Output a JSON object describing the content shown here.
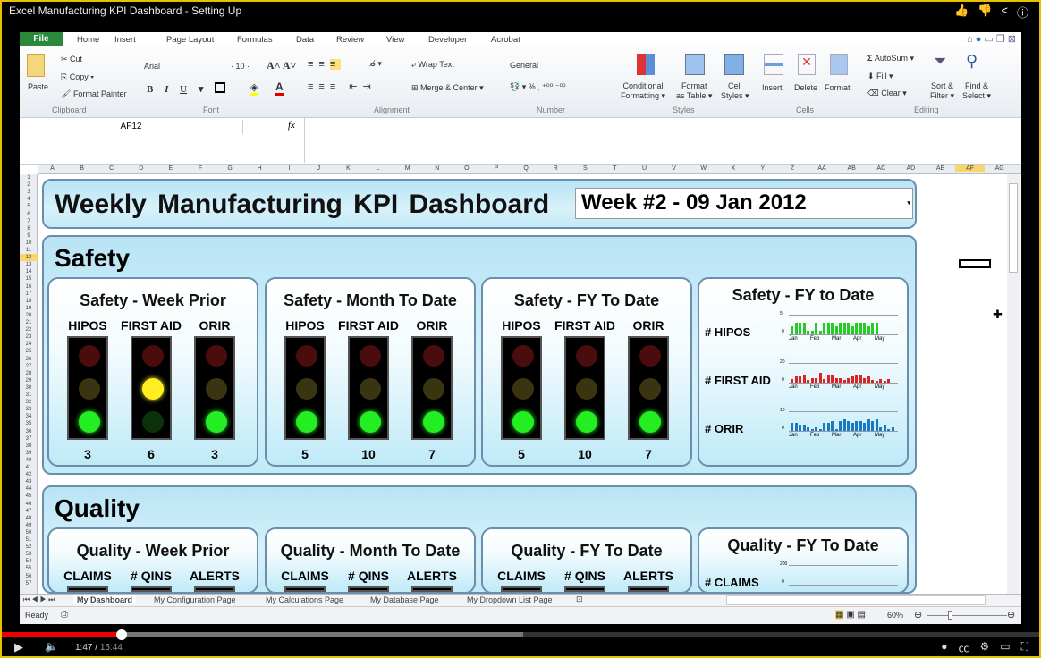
{
  "video": {
    "title": "Excel Manufacturing KPI Dashboard - Setting Up",
    "time_current": "1:47",
    "time_total": "15:44",
    "progress_pct": 11.7,
    "buffered_pct": 50.3
  },
  "ribbon": {
    "tabs": [
      "Home",
      "Insert",
      "Page Layout",
      "Formulas",
      "Data",
      "Review",
      "View",
      "Developer",
      "Acrobat"
    ],
    "file": "File",
    "paste": "Paste",
    "cut": "Cut",
    "copy": "Copy",
    "format_painter": "Format Painter",
    "font": "Arial",
    "size": "10",
    "wrap": "Wrap Text",
    "merge": "Merge & Center",
    "number_format": "General",
    "cond": "Conditional",
    "cond2": "Formatting",
    "fmt_table": "Format",
    "fmt_table2": "as Table",
    "cell_styles": "Cell",
    "cell_styles2": "Styles",
    "insert": "Insert",
    "delete": "Delete",
    "format": "Format",
    "autosum": "AutoSum",
    "fill": "Fill",
    "clear": "Clear",
    "sort": "Sort &",
    "sort2": "Filter",
    "find": "Find &",
    "find2": "Select",
    "groups": [
      "Clipboard",
      "Font",
      "Alignment",
      "Number",
      "Styles",
      "Cells",
      "Editing"
    ]
  },
  "formula": {
    "name_box": "AF12",
    "fx": "fx"
  },
  "columns": [
    "A",
    "B",
    "C",
    "D",
    "E",
    "F",
    "G",
    "H",
    "I",
    "J",
    "K",
    "L",
    "M",
    "N",
    "O",
    "P",
    "Q",
    "R",
    "S",
    "T",
    "U",
    "V",
    "W",
    "X",
    "Y",
    "Z",
    "AA",
    "AB",
    "AC",
    "AD",
    "AE",
    "AF",
    "AG"
  ],
  "selected_column": "AF",
  "selected_row": 12,
  "dashboard": {
    "title": "Weekly Manufacturing  KPI Dashboard",
    "week": "Week #2 - 09 Jan 2012",
    "sections": [
      {
        "title": "Safety",
        "panels": [
          {
            "title": "Safety  - Week Prior",
            "metrics": [
              {
                "label": "HIPOS",
                "value": "3",
                "status": "green"
              },
              {
                "label": "FIRST AID",
                "value": "6",
                "status": "yellow"
              },
              {
                "label": "ORIR",
                "value": "3",
                "status": "green"
              }
            ]
          },
          {
            "title": "Safety  - Month  To Date",
            "metrics": [
              {
                "label": "HIPOS",
                "value": "5",
                "status": "green"
              },
              {
                "label": "FIRST AID",
                "value": "10",
                "status": "green"
              },
              {
                "label": "ORIR",
                "value": "7",
                "status": "green"
              }
            ]
          },
          {
            "title": "Safety  - FY To Date",
            "metrics": [
              {
                "label": "HIPOS",
                "value": "5",
                "status": "green"
              },
              {
                "label": "FIRST AID",
                "value": "10",
                "status": "green"
              },
              {
                "label": "ORIR",
                "value": "7",
                "status": "green"
              }
            ]
          }
        ],
        "trend": {
          "title": "Safety  - FY to Date",
          "months": [
            "Jan",
            "Feb",
            "Mar",
            "Apr",
            "May"
          ],
          "series": [
            {
              "label": "# HIPOS",
              "ymax": "5",
              "ymin": "0",
              "max": 5,
              "color": "#22cc22",
              "values": [
                2,
                3,
                3,
                3,
                1,
                1,
                3,
                1,
                3,
                3,
                3,
                2,
                3,
                3,
                3,
                2,
                3,
                3,
                3,
                2,
                3,
                3
              ]
            },
            {
              "label": "# FIRST AID",
              "ymax": "20",
              "ymin": "0",
              "max": 20,
              "color": "#dd2222",
              "values": [
                4,
                6,
                6,
                8,
                3,
                5,
                5,
                10,
                4,
                7,
                8,
                5,
                5,
                3,
                5,
                6,
                7,
                8,
                5,
                6,
                3,
                2,
                4,
                2,
                4
              ]
            },
            {
              "label": "# ORIR",
              "ymax": "10",
              "ymin": "0",
              "max": 10,
              "color": "#1a7ac0",
              "values": [
                4,
                4,
                3,
                3,
                2,
                1,
                2,
                1,
                4,
                4,
                5,
                1,
                5,
                6,
                5,
                4,
                5,
                5,
                4,
                6,
                5,
                6,
                2,
                3,
                1,
                2
              ]
            }
          ]
        }
      },
      {
        "title": "Quality",
        "panels": [
          {
            "title": "Quality  - Week Prior",
            "metrics": [
              {
                "label": "CLAIMS"
              },
              {
                "label": "# QINS"
              },
              {
                "label": "ALERTS"
              }
            ]
          },
          {
            "title": "Quality  - Month  To Date",
            "metrics": [
              {
                "label": "CLAIMS"
              },
              {
                "label": "# QINS"
              },
              {
                "label": "ALERTS"
              }
            ]
          },
          {
            "title": "Quality  - FY To Date",
            "metrics": [
              {
                "label": "CLAIMS"
              },
              {
                "label": "# QINS"
              },
              {
                "label": "ALERTS"
              }
            ]
          }
        ],
        "trend": {
          "title": "Quality  - FY To Date",
          "series": [
            {
              "label": "# CLAIMS",
              "ymax": "200",
              "ymin": "0",
              "color": "#22cc22"
            }
          ]
        }
      }
    ]
  },
  "sheet_tabs": [
    "My Dashboard",
    "My Configuration Page",
    "My Calculations Page",
    "My Database Page",
    "My Dropdown List Page"
  ],
  "active_sheet": "My Dashboard",
  "status": {
    "ready": "Ready",
    "zoom": "60%"
  },
  "colors": {
    "green_on": "#22ee22",
    "yellow_on": "#ffee22",
    "red_off": "#4a0c0c",
    "yellow_off": "#3a3410",
    "green_off": "#0b320b",
    "panel_border": "#6a8fae"
  }
}
